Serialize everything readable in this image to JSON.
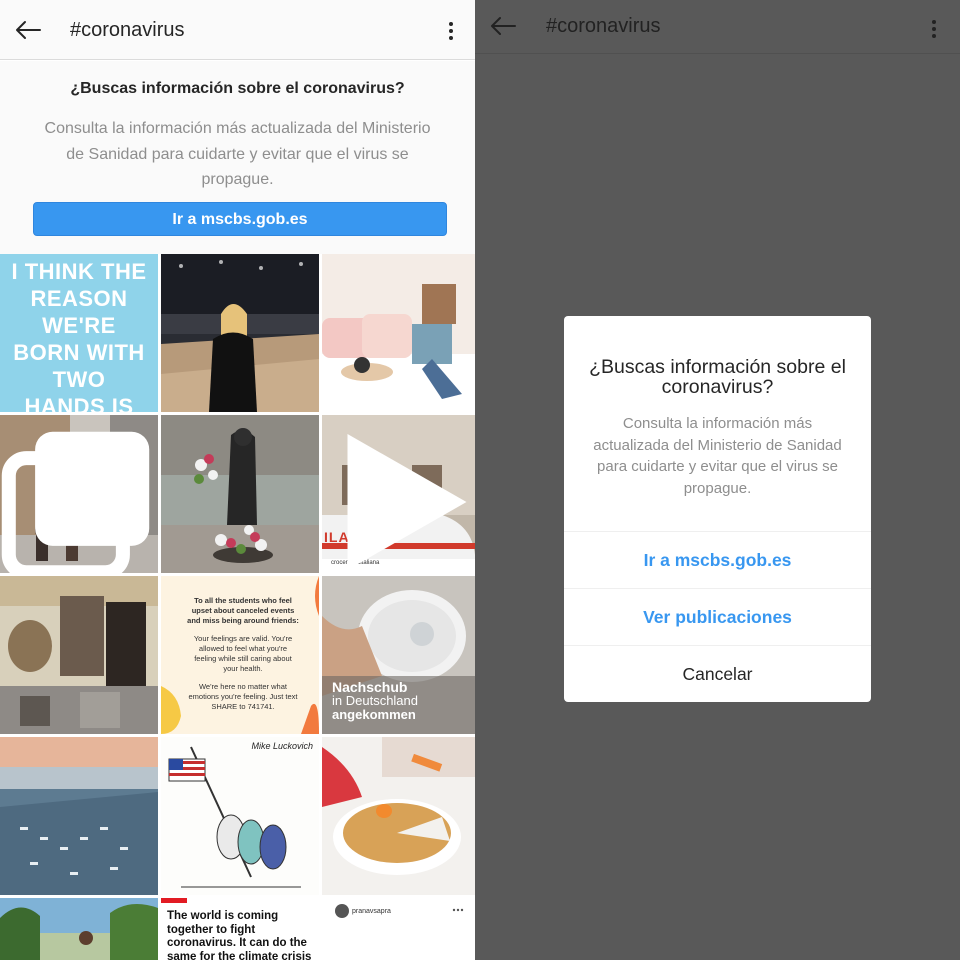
{
  "left": {
    "header": {
      "title": "#coronavirus"
    },
    "info_card": {
      "question": "¿Buscas información sobre el coronavirus?",
      "description": "Consulta la información más actualizada del Ministerio de Sanidad para cuidarte y evitar que el virus se propague.",
      "link_label": "Ir a mscbs.gob.es"
    },
    "tiles": {
      "quote_text": "I THINK THE REASON WE'RE BORN WITH TWO HANDS IS SO WE CAN PET TWO DOGS AT ONCE.",
      "ilano_text": "ILANO",
      "ilano_tag": "crocerossaitaliana",
      "students_title": "To all the students who feel upset about canceled events and miss being around friends:",
      "students_body": "Your feelings are valid. You're allowed to feel what you're feeling while still caring about your health.",
      "students_footer": "We're here no matter what emotions you're feeling. Just text SHARE to 741741.",
      "mask_title": "Nachschub",
      "mask_sub": "in Deutschland",
      "mask_title2": "angekommen",
      "cartoon_sig": "Mike Luckovich",
      "world_text": "The world is coming together to fight coronavirus. It can do the same for the climate crisis",
      "insta_user": "pranavsapra"
    }
  },
  "right": {
    "header": {
      "title": "#coronavirus"
    },
    "dialog": {
      "title": "¿Buscas información sobre el coronavirus?",
      "description": "Consulta la información más actualizada del Ministerio de Sanidad para cuidarte y evitar que el virus se propague.",
      "buttons": [
        "Ir a mscbs.gob.es",
        "Ver publicaciones",
        "Cancelar"
      ]
    }
  },
  "colors": {
    "accent": "#3897f0",
    "overlay": "#595959",
    "secondary_text": "#8e8e8e"
  }
}
